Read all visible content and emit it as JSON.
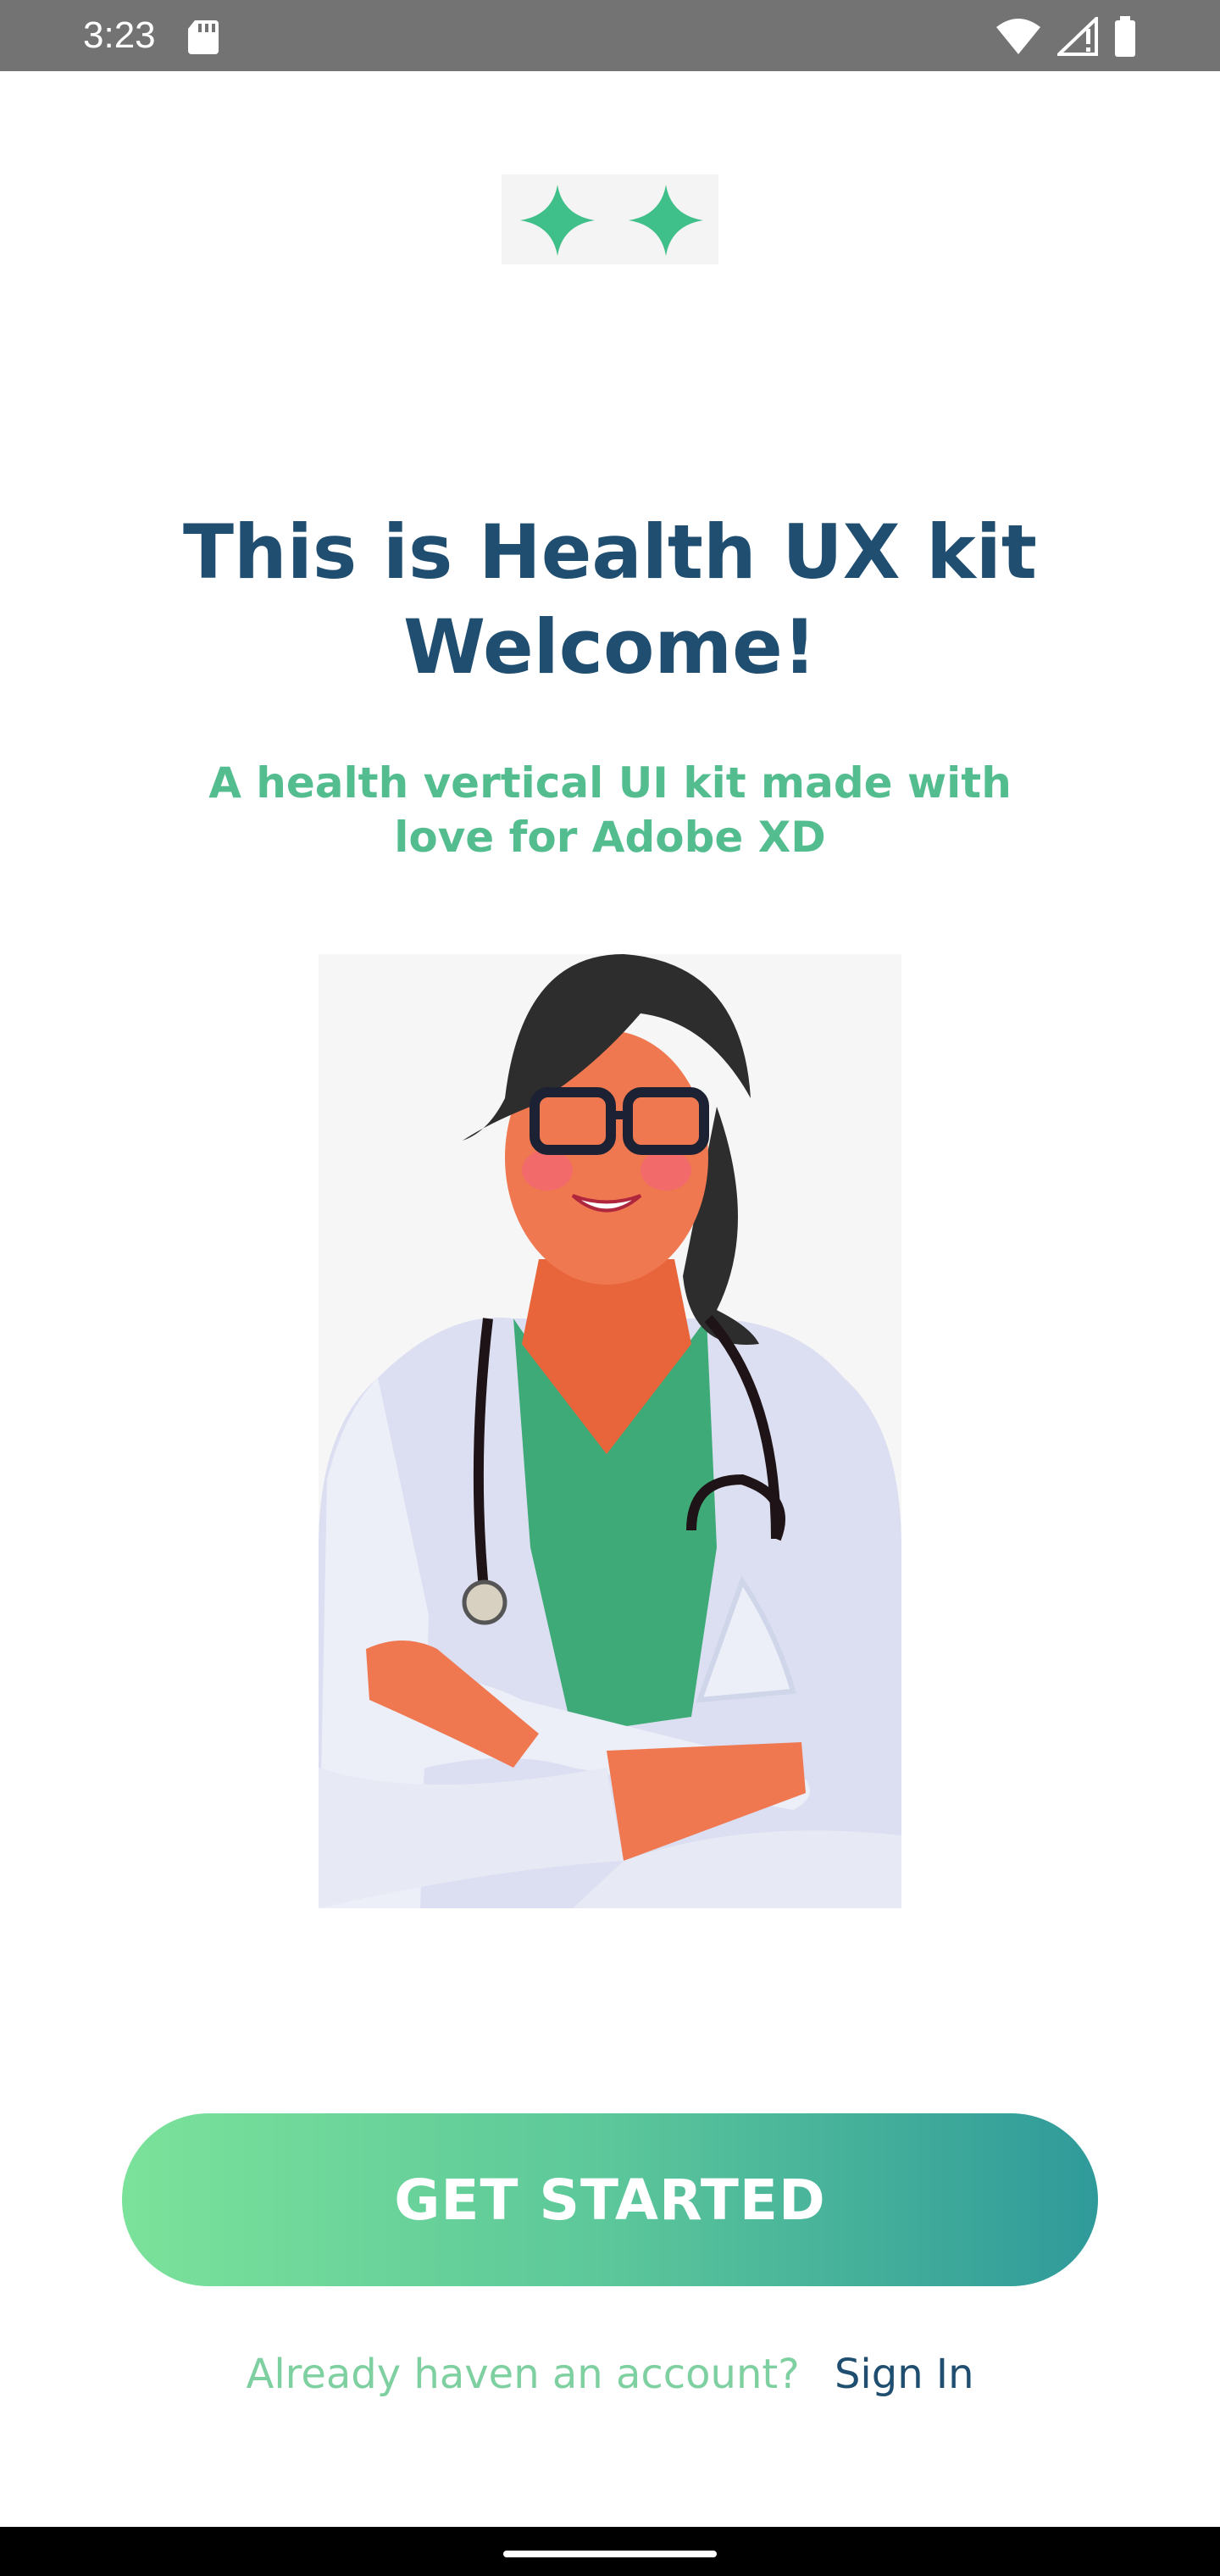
{
  "status_bar": {
    "time": "3:23",
    "icons": [
      "sd-card-icon",
      "wifi-icon",
      "signal-icon",
      "battery-icon"
    ]
  },
  "logo": {
    "icon": "health-plus-logo-icon",
    "color": "#3fbf8a"
  },
  "welcome": {
    "title_line1": "This is Health UX kit",
    "title_line2": "Welcome!",
    "subtitle_line1": "A health vertical UI kit made with",
    "subtitle_line2": "love for Adobe XD"
  },
  "illustration": {
    "icon": "doctor-illustration"
  },
  "actions": {
    "get_started_label": "GET STARTED",
    "signin_prompt": "Already haven an account?",
    "signin_link": "Sign In"
  },
  "colors": {
    "title": "#1f4e70",
    "subtitle": "#53bd90",
    "button_start": "#7be29a",
    "button_end": "#2f9a9a",
    "status_bar": "#737373"
  }
}
